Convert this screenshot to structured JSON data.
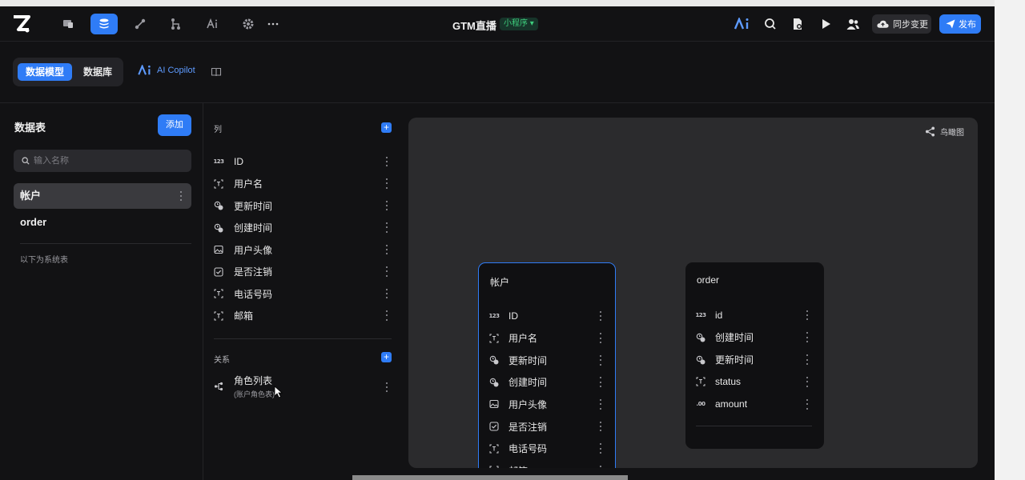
{
  "header": {
    "title": "GTM直播",
    "badge": "小程序 ▾",
    "sync_label": "同步变更",
    "publish_label": "发布",
    "nav_icons": [
      "pages-icon",
      "database-icon",
      "workflow-icon",
      "branch-icon",
      "ai-icon",
      "settings-icon",
      "more-icon"
    ],
    "tool_icons": [
      "ai-logo-icon",
      "search-icon",
      "document-icon",
      "play-icon",
      "users-icon"
    ]
  },
  "subtabs": {
    "model": "数据模型",
    "database": "数据库",
    "copilot": "AI Copilot"
  },
  "left_panel": {
    "title": "数据表",
    "add_label": "添加",
    "search_placeholder": "输入名称",
    "tables": [
      {
        "name": "帐户",
        "selected": true
      },
      {
        "name": "order",
        "selected": false
      }
    ],
    "system_label": "以下为系统表"
  },
  "columns_panel": {
    "columns_label": "列",
    "columns": [
      {
        "name": "ID",
        "icon": "number-icon"
      },
      {
        "name": "用户名",
        "icon": "text-icon"
      },
      {
        "name": "更新时间",
        "icon": "datetime-icon"
      },
      {
        "name": "创建时间",
        "icon": "datetime-icon"
      },
      {
        "name": "用户头像",
        "icon": "image-icon"
      },
      {
        "name": "是否注销",
        "icon": "checkbox-icon"
      },
      {
        "name": "电话号码",
        "icon": "text-icon"
      },
      {
        "name": "邮箱",
        "icon": "text-icon"
      }
    ],
    "relations_label": "关系",
    "relations": [
      {
        "name": "角色列表",
        "subtitle": "(账户角色表)"
      }
    ]
  },
  "canvas": {
    "birdseye_label": "鸟瞰图",
    "account_card": {
      "title": "帐户",
      "fields": [
        "ID",
        "用户名",
        "更新时间",
        "创建时间",
        "用户头像",
        "是否注销",
        "电话号码",
        "邮箱"
      ]
    },
    "order_card": {
      "title": "order",
      "fields": [
        "id",
        "创建时间",
        "更新时间",
        "status",
        "amount"
      ]
    }
  },
  "colors": {
    "accent": "#2f7cf6",
    "background": "#121214",
    "canvas": "#2b2b2d",
    "badge_text": "#3ecf7d"
  }
}
